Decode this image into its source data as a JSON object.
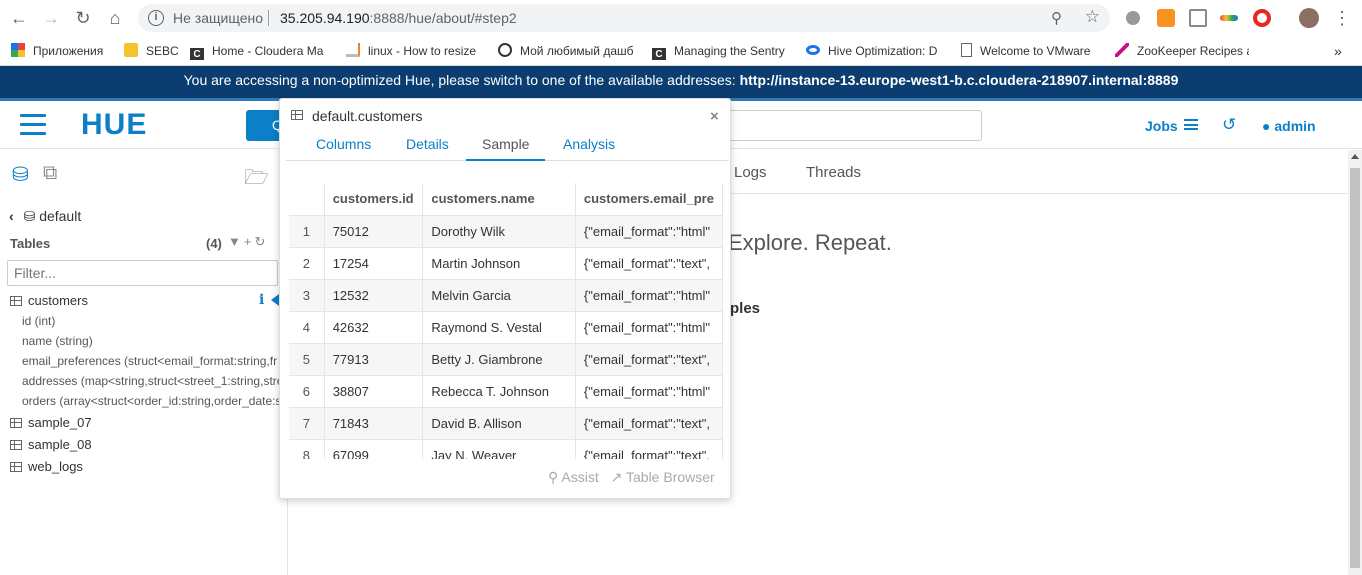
{
  "browser": {
    "security_label": "Не защищено",
    "url_host": "35.205.94.190",
    "url_path": ":8888/hue/about/#step2"
  },
  "bookmarks": [
    {
      "label": "Приложения",
      "icon": "apps-grid-icon",
      "color": "#e8453c"
    },
    {
      "label": "SEBC",
      "icon": "folder-icon",
      "color": "#f4c430"
    },
    {
      "label": "Home - Cloudera Ma",
      "icon": "cloudera-c-icon",
      "color": "#333333"
    },
    {
      "label": "linux - How to resize",
      "icon": "stackoverflow-icon",
      "color": "#f48024"
    },
    {
      "label": "Мой любимый дашб",
      "icon": "jenkins-icon",
      "color": "#333333"
    },
    {
      "label": "Managing the Sentry",
      "icon": "cloudera-c-icon",
      "color": "#333333"
    },
    {
      "label": "Hive Optimization: D",
      "icon": "link-loop-icon",
      "color": "#1a73e8"
    },
    {
      "label": "Welcome to VMware",
      "icon": "page-icon",
      "color": "#666666"
    },
    {
      "label": "ZooKeeper Recipes a",
      "icon": "feather-icon",
      "color": "#c71585"
    }
  ],
  "banner": {
    "text": "You are accessing a non-optimized Hue, please switch to one of the available addresses:",
    "address": "http://instance-13.europe-west1-b.c.cloudera-218907.internal:8889"
  },
  "header": {
    "logo": "HUE",
    "query_button_label": "Q",
    "jobs_label": "Jobs",
    "user_label": "admin"
  },
  "assist": {
    "database": "default",
    "tables_heading": "Tables",
    "tables_count": "(4)",
    "filter_placeholder": "Filter...",
    "tables": [
      {
        "name": "customers"
      },
      {
        "name": "sample_07"
      },
      {
        "name": "sample_08"
      },
      {
        "name": "web_logs"
      }
    ],
    "columns": [
      "id (int)",
      "name (string)",
      "email_preferences (struct<email_format:string,fr",
      "addresses (map<string,struct<street_1:string,stre",
      "orders (array<struct<order_id:string,order_date:s"
    ]
  },
  "main": {
    "tabs": [
      {
        "label": "Logs"
      },
      {
        "label": "Threads"
      }
    ],
    "headline": "Explore. Repeat.",
    "subhead": "ples"
  },
  "popover": {
    "title": "default.customers",
    "tabs": [
      {
        "label": "Columns",
        "active": false
      },
      {
        "label": "Details",
        "active": false
      },
      {
        "label": "Sample",
        "active": true
      },
      {
        "label": "Analysis",
        "active": false
      }
    ],
    "columns": [
      "",
      "customers.id",
      "customers.name",
      "customers.email_pre"
    ],
    "rows": [
      [
        "1",
        "75012",
        "Dorothy Wilk",
        "{\"email_format\":\"html\""
      ],
      [
        "2",
        "17254",
        "Martin Johnson",
        "{\"email_format\":\"text\","
      ],
      [
        "3",
        "12532",
        "Melvin Garcia",
        "{\"email_format\":\"html\""
      ],
      [
        "4",
        "42632",
        "Raymond S. Vestal",
        "{\"email_format\":\"html\""
      ],
      [
        "5",
        "77913",
        "Betty J. Giambrone",
        "{\"email_format\":\"text\","
      ],
      [
        "6",
        "38807",
        "Rebecca T. Johnson",
        "{\"email_format\":\"html\""
      ],
      [
        "7",
        "71843",
        "David B. Allison",
        "{\"email_format\":\"text\","
      ],
      [
        "8",
        "67099",
        "Jay N. Weaver",
        "{\"email_format\":\"text\","
      ]
    ],
    "footer": {
      "assist_label": "Assist",
      "table_browser_label": "Table Browser"
    }
  },
  "colors": {
    "hue_blue": "#0b7fc7",
    "banner_bg": "#0b3d70"
  }
}
